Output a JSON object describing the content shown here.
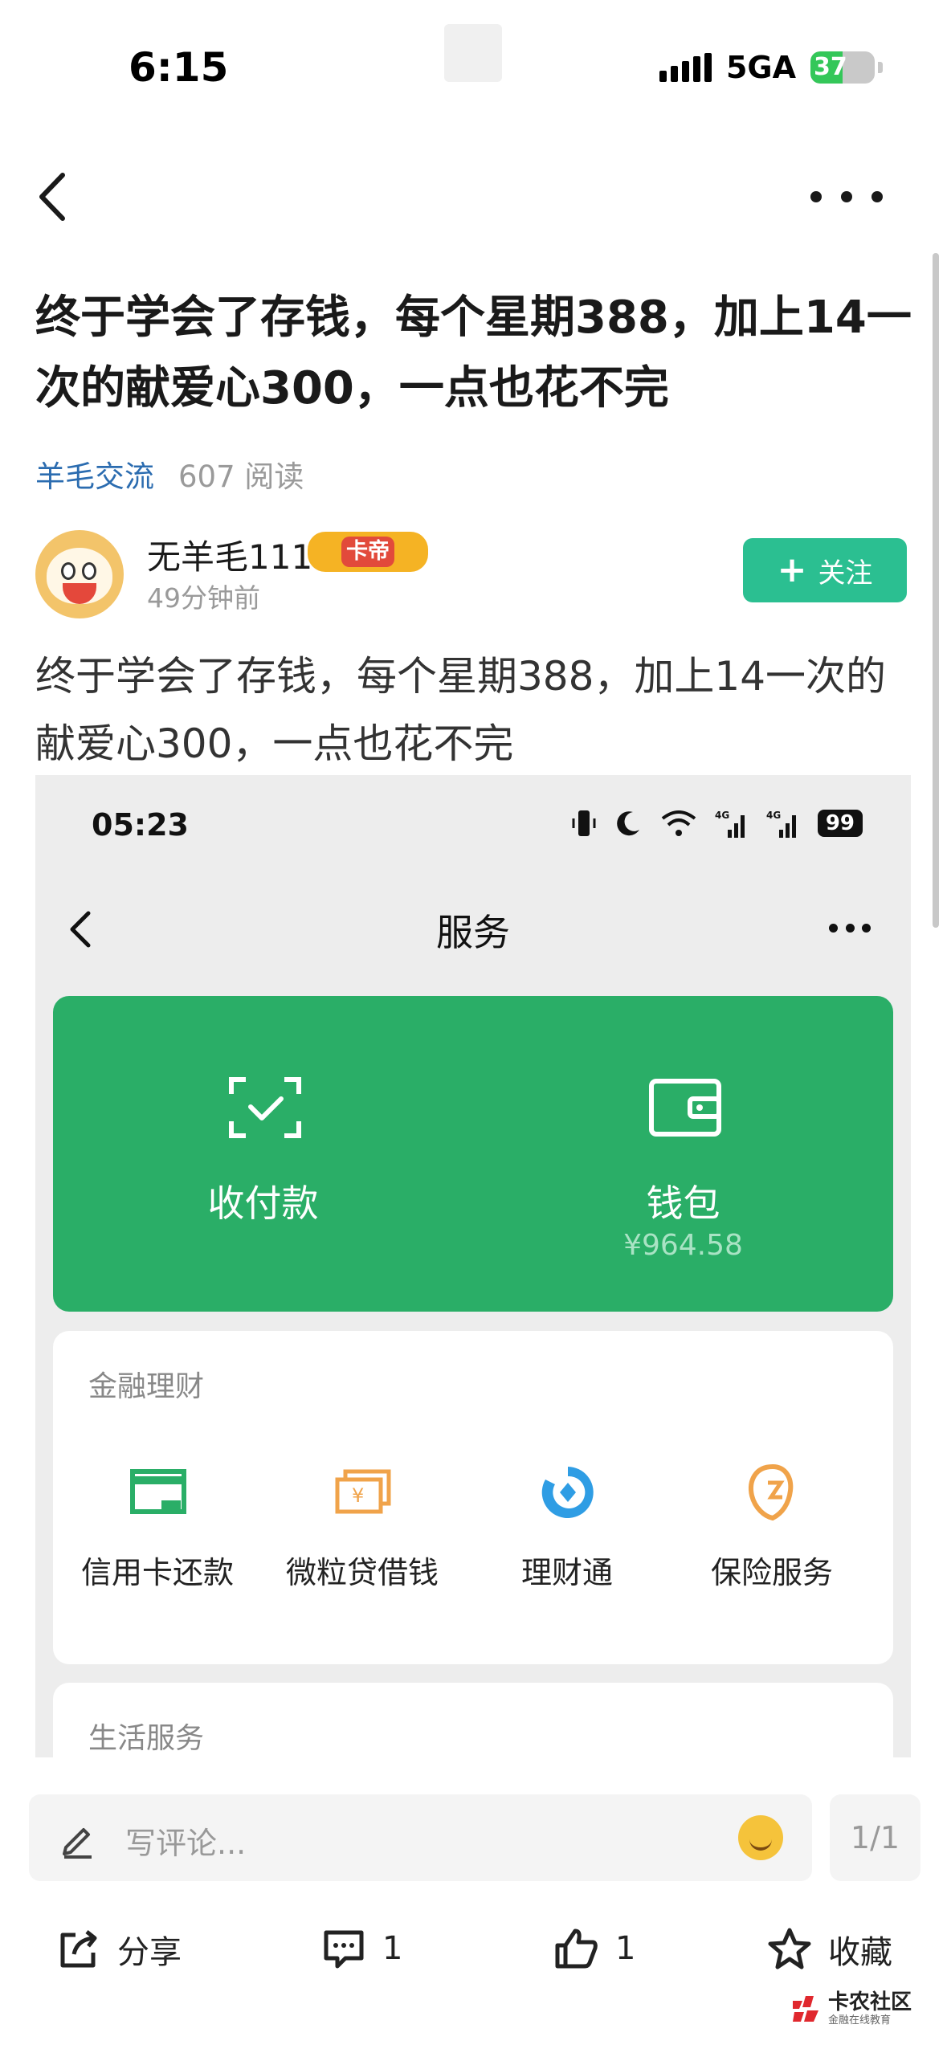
{
  "status_bar": {
    "time": "6:15",
    "network": "5GA",
    "battery": "37"
  },
  "post": {
    "title": "终于学会了存钱，每个星期388，加上14一次的献爱心300，一点也花不完",
    "category": "羊毛交流",
    "reads": "607 阅读",
    "author": {
      "name": "无羊毛111",
      "badge": "卡帝",
      "time": "49分钟前"
    },
    "follow_label": "关注",
    "body": "终于学会了存钱，每个星期388，加上14一次的献爱心300，一点也花不完"
  },
  "embedded": {
    "time": "05:23",
    "battery": "99",
    "title": "服务",
    "green_card": {
      "pay_label": "收付款",
      "wallet_label": "钱包",
      "wallet_amount": "¥964.58"
    },
    "finance": {
      "title": "金融理财",
      "items": [
        {
          "label": "信用卡还款",
          "icon": "credit-card-icon",
          "color": "#2aae67"
        },
        {
          "label": "微粒贷借钱",
          "icon": "loan-icon",
          "color": "#f0a34a"
        },
        {
          "label": "理财通",
          "icon": "wealth-icon",
          "color": "#2f9de4"
        },
        {
          "label": "保险服务",
          "icon": "insurance-icon",
          "color": "#f0a34a"
        }
      ]
    },
    "life": {
      "title": "生活服务"
    }
  },
  "bottom": {
    "comment_placeholder": "写评论...",
    "page_counter": "1/1",
    "share_label": "分享",
    "comment_count": "1",
    "like_count": "1",
    "favorite_label": "收藏"
  },
  "watermark": {
    "main": "卡农社区",
    "sub": "金融在线教育"
  },
  "colors": {
    "accent_green": "#2bbf91",
    "wallet_green": "#2aae67",
    "link_blue": "#2b6cb0"
  }
}
